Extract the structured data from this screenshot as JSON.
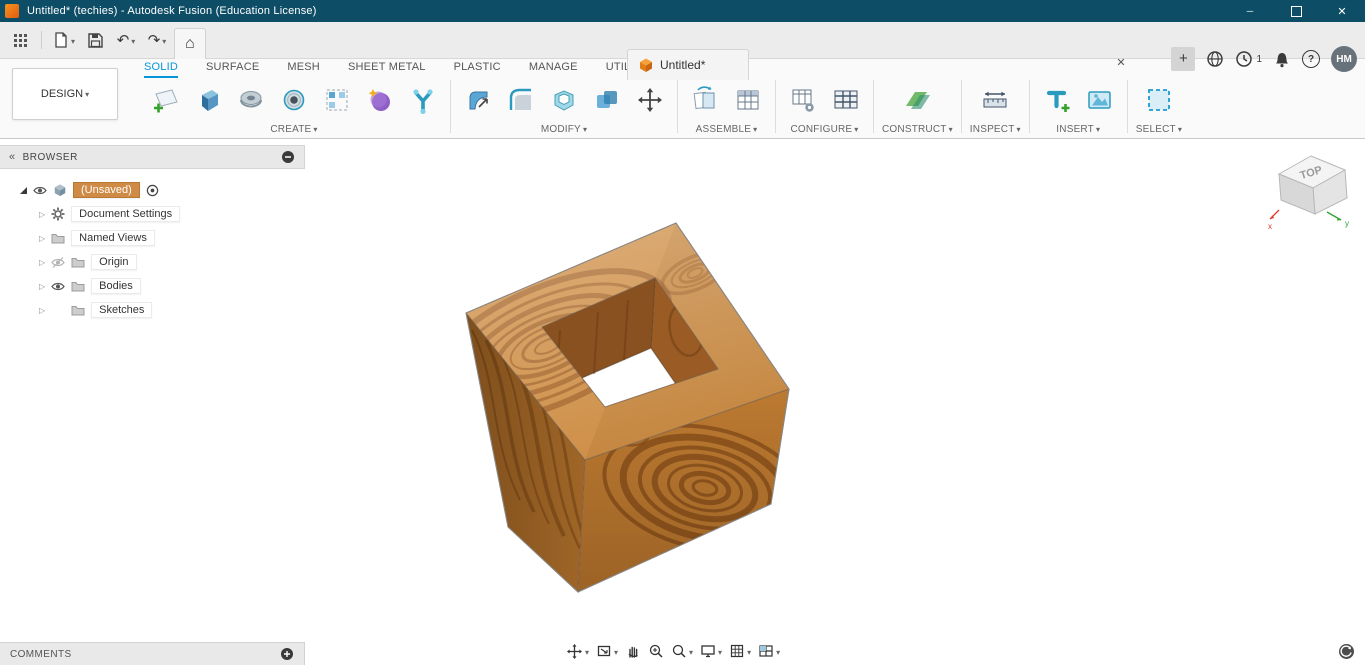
{
  "window": {
    "title": "Untitled* (techies) - Autodesk Fusion (Education License)"
  },
  "app_bar": {
    "tab_label": "Untitled*",
    "clock_badge": "1",
    "avatar_initials": "HM"
  },
  "ribbon": {
    "workspace": "DESIGN",
    "tabs": [
      {
        "label": "SOLID",
        "active": true
      },
      {
        "label": "SURFACE"
      },
      {
        "label": "MESH"
      },
      {
        "label": "SHEET METAL"
      },
      {
        "label": "PLASTIC"
      },
      {
        "label": "MANAGE"
      },
      {
        "label": "UTILITIES"
      }
    ],
    "groups": [
      {
        "label": "CREATE"
      },
      {
        "label": "MODIFY"
      },
      {
        "label": "ASSEMBLE"
      },
      {
        "label": "CONFIGURE"
      },
      {
        "label": "CONSTRUCT"
      },
      {
        "label": "INSPECT"
      },
      {
        "label": "INSERT"
      },
      {
        "label": "SELECT"
      }
    ]
  },
  "browser": {
    "header": "BROWSER",
    "root_label": "(Unsaved)",
    "items": [
      {
        "label": "Document Settings"
      },
      {
        "label": "Named Views"
      },
      {
        "label": "Origin"
      },
      {
        "label": "Bodies"
      },
      {
        "label": "Sketches"
      }
    ]
  },
  "viewcube": {
    "face": "TOP",
    "axis_x": "x",
    "axis_y": "y"
  },
  "comments": {
    "label": "COMMENTS"
  },
  "colors": {
    "accent": "#0696D7",
    "titlebar": "#0E4D66",
    "selection_orange": "#CF8A45"
  }
}
